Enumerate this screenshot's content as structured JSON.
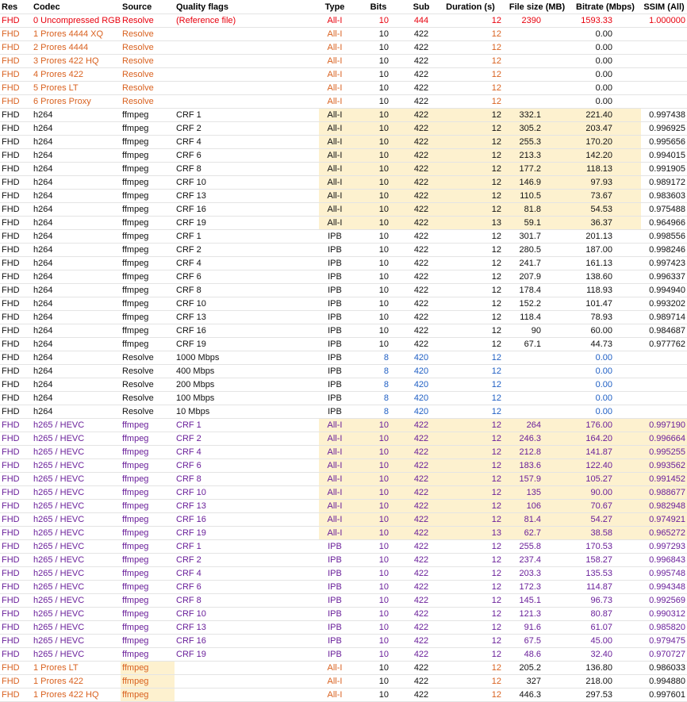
{
  "columns": [
    "Res",
    "Codec",
    "Source",
    "Quality flags",
    "Type",
    "Bits",
    "Sub",
    "Duration (s)",
    "File size (MB)",
    "Bitrate (Mbps)",
    "SSIM (All)"
  ],
  "colors": {
    "red": "#e8000d",
    "orange": "#d9611f",
    "black": "#111111",
    "blue": "#1f5fc4",
    "purple": "#6a1f9a",
    "highlight": "#fdf1cf"
  },
  "rows": [
    {
      "cells": [
        "FHD",
        "0 Uncompressed RGB",
        "Resolve",
        "(Reference file)",
        "All-I",
        "10",
        "444",
        "12",
        "2390",
        "1593.33",
        "1.000000"
      ],
      "color": "red",
      "hl": []
    },
    {
      "cells": [
        "FHD",
        "1 Prores 4444 XQ",
        "Resolve",
        "",
        "All-I",
        "10",
        "422",
        "12",
        "",
        "0.00",
        ""
      ],
      "color": "orange",
      "black": [
        5,
        6,
        9
      ],
      "hl": []
    },
    {
      "cells": [
        "FHD",
        "2 Prores 4444",
        "Resolve",
        "",
        "All-I",
        "10",
        "422",
        "12",
        "",
        "0.00",
        ""
      ],
      "color": "orange",
      "black": [
        5,
        6,
        9
      ],
      "hl": []
    },
    {
      "cells": [
        "FHD",
        "3 Prores 422 HQ",
        "Resolve",
        "",
        "All-I",
        "10",
        "422",
        "12",
        "",
        "0.00",
        ""
      ],
      "color": "orange",
      "black": [
        5,
        6,
        9
      ],
      "hl": []
    },
    {
      "cells": [
        "FHD",
        "4 Prores 422",
        "Resolve",
        "",
        "All-I",
        "10",
        "422",
        "12",
        "",
        "0.00",
        ""
      ],
      "color": "orange",
      "black": [
        5,
        6,
        9
      ],
      "hl": []
    },
    {
      "cells": [
        "FHD",
        "5 Prores LT",
        "Resolve",
        "",
        "All-I",
        "10",
        "422",
        "12",
        "",
        "0.00",
        ""
      ],
      "color": "orange",
      "black": [
        5,
        6,
        9
      ],
      "hl": []
    },
    {
      "cells": [
        "FHD",
        "6 Prores Proxy",
        "Resolve",
        "",
        "All-I",
        "10",
        "422",
        "12",
        "",
        "0.00",
        ""
      ],
      "color": "orange",
      "black": [
        5,
        6,
        9
      ],
      "hl": []
    },
    {
      "cells": [
        "FHD",
        "h264",
        "ffmpeg",
        "CRF 1",
        "All-I",
        "10",
        "422",
        "12",
        "332.1",
        "221.40",
        "0.997438"
      ],
      "color": "black",
      "hl": [
        4,
        5,
        6,
        7,
        8,
        9
      ]
    },
    {
      "cells": [
        "FHD",
        "h264",
        "ffmpeg",
        "CRF 2",
        "All-I",
        "10",
        "422",
        "12",
        "305.2",
        "203.47",
        "0.996925"
      ],
      "color": "black",
      "hl": [
        4,
        5,
        6,
        7,
        8,
        9
      ]
    },
    {
      "cells": [
        "FHD",
        "h264",
        "ffmpeg",
        "CRF 4",
        "All-I",
        "10",
        "422",
        "12",
        "255.3",
        "170.20",
        "0.995656"
      ],
      "color": "black",
      "hl": [
        4,
        5,
        6,
        7,
        8,
        9
      ]
    },
    {
      "cells": [
        "FHD",
        "h264",
        "ffmpeg",
        "CRF 6",
        "All-I",
        "10",
        "422",
        "12",
        "213.3",
        "142.20",
        "0.994015"
      ],
      "color": "black",
      "hl": [
        4,
        5,
        6,
        7,
        8,
        9
      ]
    },
    {
      "cells": [
        "FHD",
        "h264",
        "ffmpeg",
        "CRF 8",
        "All-I",
        "10",
        "422",
        "12",
        "177.2",
        "118.13",
        "0.991905"
      ],
      "color": "black",
      "hl": [
        4,
        5,
        6,
        7,
        8,
        9
      ]
    },
    {
      "cells": [
        "FHD",
        "h264",
        "ffmpeg",
        "CRF 10",
        "All-I",
        "10",
        "422",
        "12",
        "146.9",
        "97.93",
        "0.989172"
      ],
      "color": "black",
      "hl": [
        4,
        5,
        6,
        7,
        8,
        9
      ]
    },
    {
      "cells": [
        "FHD",
        "h264",
        "ffmpeg",
        "CRF 13",
        "All-I",
        "10",
        "422",
        "12",
        "110.5",
        "73.67",
        "0.983603"
      ],
      "color": "black",
      "hl": [
        4,
        5,
        6,
        7,
        8,
        9
      ]
    },
    {
      "cells": [
        "FHD",
        "h264",
        "ffmpeg",
        "CRF 16",
        "All-I",
        "10",
        "422",
        "12",
        "81.8",
        "54.53",
        "0.975488"
      ],
      "color": "black",
      "hl": [
        4,
        5,
        6,
        7,
        8,
        9
      ]
    },
    {
      "cells": [
        "FHD",
        "h264",
        "ffmpeg",
        "CRF 19",
        "All-I",
        "10",
        "422",
        "13",
        "59.1",
        "36.37",
        "0.964966"
      ],
      "color": "black",
      "hl": [
        4,
        5,
        6,
        7,
        8,
        9
      ]
    },
    {
      "cells": [
        "FHD",
        "h264",
        "ffmpeg",
        "CRF 1",
        "IPB",
        "10",
        "422",
        "12",
        "301.7",
        "201.13",
        "0.998556"
      ],
      "color": "black",
      "hl": []
    },
    {
      "cells": [
        "FHD",
        "h264",
        "ffmpeg",
        "CRF 2",
        "IPB",
        "10",
        "422",
        "12",
        "280.5",
        "187.00",
        "0.998246"
      ],
      "color": "black",
      "hl": []
    },
    {
      "cells": [
        "FHD",
        "h264",
        "ffmpeg",
        "CRF 4",
        "IPB",
        "10",
        "422",
        "12",
        "241.7",
        "161.13",
        "0.997423"
      ],
      "color": "black",
      "hl": []
    },
    {
      "cells": [
        "FHD",
        "h264",
        "ffmpeg",
        "CRF 6",
        "IPB",
        "10",
        "422",
        "12",
        "207.9",
        "138.60",
        "0.996337"
      ],
      "color": "black",
      "hl": []
    },
    {
      "cells": [
        "FHD",
        "h264",
        "ffmpeg",
        "CRF 8",
        "IPB",
        "10",
        "422",
        "12",
        "178.4",
        "118.93",
        "0.994940"
      ],
      "color": "black",
      "hl": []
    },
    {
      "cells": [
        "FHD",
        "h264",
        "ffmpeg",
        "CRF 10",
        "IPB",
        "10",
        "422",
        "12",
        "152.2",
        "101.47",
        "0.993202"
      ],
      "color": "black",
      "hl": []
    },
    {
      "cells": [
        "FHD",
        "h264",
        "ffmpeg",
        "CRF 13",
        "IPB",
        "10",
        "422",
        "12",
        "118.4",
        "78.93",
        "0.989714"
      ],
      "color": "black",
      "hl": []
    },
    {
      "cells": [
        "FHD",
        "h264",
        "ffmpeg",
        "CRF 16",
        "IPB",
        "10",
        "422",
        "12",
        "90",
        "60.00",
        "0.984687"
      ],
      "color": "black",
      "hl": []
    },
    {
      "cells": [
        "FHD",
        "h264",
        "ffmpeg",
        "CRF 19",
        "IPB",
        "10",
        "422",
        "12",
        "67.1",
        "44.73",
        "0.977762"
      ],
      "color": "black",
      "hl": []
    },
    {
      "cells": [
        "FHD",
        "h264",
        "Resolve",
        "1000 Mbps",
        "IPB",
        "8",
        "420",
        "12",
        "",
        "0.00",
        ""
      ],
      "color": "black",
      "blue": [
        5,
        6,
        7,
        9
      ],
      "hl": []
    },
    {
      "cells": [
        "FHD",
        "h264",
        "Resolve",
        "400 Mbps",
        "IPB",
        "8",
        "420",
        "12",
        "",
        "0.00",
        ""
      ],
      "color": "black",
      "blue": [
        5,
        6,
        7,
        9
      ],
      "hl": []
    },
    {
      "cells": [
        "FHD",
        "h264",
        "Resolve",
        "200 Mbps",
        "IPB",
        "8",
        "420",
        "12",
        "",
        "0.00",
        ""
      ],
      "color": "black",
      "blue": [
        5,
        6,
        7,
        9
      ],
      "hl": []
    },
    {
      "cells": [
        "FHD",
        "h264",
        "Resolve",
        "100 Mbps",
        "IPB",
        "8",
        "420",
        "12",
        "",
        "0.00",
        ""
      ],
      "color": "black",
      "blue": [
        5,
        6,
        7,
        9
      ],
      "hl": []
    },
    {
      "cells": [
        "FHD",
        "h264",
        "Resolve",
        "10 Mbps",
        "IPB",
        "8",
        "420",
        "12",
        "",
        "0.00",
        ""
      ],
      "color": "black",
      "blue": [
        5,
        6,
        7,
        9
      ],
      "hl": []
    },
    {
      "cells": [
        "FHD",
        "h265 / HEVC",
        "ffmpeg",
        "CRF 1",
        "All-I",
        "10",
        "422",
        "12",
        "264",
        "176.00",
        "0.997190"
      ],
      "color": "purple",
      "hl": [
        4,
        5,
        6,
        7,
        8,
        9,
        10
      ]
    },
    {
      "cells": [
        "FHD",
        "h265 / HEVC",
        "ffmpeg",
        "CRF 2",
        "All-I",
        "10",
        "422",
        "12",
        "246.3",
        "164.20",
        "0.996664"
      ],
      "color": "purple",
      "hl": [
        4,
        5,
        6,
        7,
        8,
        9,
        10
      ]
    },
    {
      "cells": [
        "FHD",
        "h265 / HEVC",
        "ffmpeg",
        "CRF 4",
        "All-I",
        "10",
        "422",
        "12",
        "212.8",
        "141.87",
        "0.995255"
      ],
      "color": "purple",
      "hl": [
        4,
        5,
        6,
        7,
        8,
        9,
        10
      ]
    },
    {
      "cells": [
        "FHD",
        "h265 / HEVC",
        "ffmpeg",
        "CRF 6",
        "All-I",
        "10",
        "422",
        "12",
        "183.6",
        "122.40",
        "0.993562"
      ],
      "color": "purple",
      "hl": [
        4,
        5,
        6,
        7,
        8,
        9,
        10
      ]
    },
    {
      "cells": [
        "FHD",
        "h265 / HEVC",
        "ffmpeg",
        "CRF 8",
        "All-I",
        "10",
        "422",
        "12",
        "157.9",
        "105.27",
        "0.991452"
      ],
      "color": "purple",
      "hl": [
        4,
        5,
        6,
        7,
        8,
        9,
        10
      ]
    },
    {
      "cells": [
        "FHD",
        "h265 / HEVC",
        "ffmpeg",
        "CRF 10",
        "All-I",
        "10",
        "422",
        "12",
        "135",
        "90.00",
        "0.988677"
      ],
      "color": "purple",
      "hl": [
        4,
        5,
        6,
        7,
        8,
        9,
        10
      ]
    },
    {
      "cells": [
        "FHD",
        "h265 / HEVC",
        "ffmpeg",
        "CRF 13",
        "All-I",
        "10",
        "422",
        "12",
        "106",
        "70.67",
        "0.982948"
      ],
      "color": "purple",
      "hl": [
        4,
        5,
        6,
        7,
        8,
        9,
        10
      ]
    },
    {
      "cells": [
        "FHD",
        "h265 / HEVC",
        "ffmpeg",
        "CRF 16",
        "All-I",
        "10",
        "422",
        "12",
        "81.4",
        "54.27",
        "0.974921"
      ],
      "color": "purple",
      "hl": [
        4,
        5,
        6,
        7,
        8,
        9,
        10
      ]
    },
    {
      "cells": [
        "FHD",
        "h265 / HEVC",
        "ffmpeg",
        "CRF 19",
        "All-I",
        "10",
        "422",
        "13",
        "62.7",
        "38.58",
        "0.965272"
      ],
      "color": "purple",
      "hl": [
        4,
        5,
        6,
        7,
        8,
        9,
        10
      ]
    },
    {
      "cells": [
        "FHD",
        "h265 / HEVC",
        "ffmpeg",
        "CRF 1",
        "IPB",
        "10",
        "422",
        "12",
        "255.8",
        "170.53",
        "0.997293"
      ],
      "color": "purple",
      "hl": []
    },
    {
      "cells": [
        "FHD",
        "h265 / HEVC",
        "ffmpeg",
        "CRF 2",
        "IPB",
        "10",
        "422",
        "12",
        "237.4",
        "158.27",
        "0.996843"
      ],
      "color": "purple",
      "hl": []
    },
    {
      "cells": [
        "FHD",
        "h265 / HEVC",
        "ffmpeg",
        "CRF 4",
        "IPB",
        "10",
        "422",
        "12",
        "203.3",
        "135.53",
        "0.995748"
      ],
      "color": "purple",
      "hl": []
    },
    {
      "cells": [
        "FHD",
        "h265 / HEVC",
        "ffmpeg",
        "CRF 6",
        "IPB",
        "10",
        "422",
        "12",
        "172.3",
        "114.87",
        "0.994348"
      ],
      "color": "purple",
      "hl": []
    },
    {
      "cells": [
        "FHD",
        "h265 / HEVC",
        "ffmpeg",
        "CRF 8",
        "IPB",
        "10",
        "422",
        "12",
        "145.1",
        "96.73",
        "0.992569"
      ],
      "color": "purple",
      "hl": []
    },
    {
      "cells": [
        "FHD",
        "h265 / HEVC",
        "ffmpeg",
        "CRF 10",
        "IPB",
        "10",
        "422",
        "12",
        "121.3",
        "80.87",
        "0.990312"
      ],
      "color": "purple",
      "hl": []
    },
    {
      "cells": [
        "FHD",
        "h265 / HEVC",
        "ffmpeg",
        "CRF 13",
        "IPB",
        "10",
        "422",
        "12",
        "91.6",
        "61.07",
        "0.985820"
      ],
      "color": "purple",
      "hl": []
    },
    {
      "cells": [
        "FHD",
        "h265 / HEVC",
        "ffmpeg",
        "CRF 16",
        "IPB",
        "10",
        "422",
        "12",
        "67.5",
        "45.00",
        "0.979475"
      ],
      "color": "purple",
      "hl": []
    },
    {
      "cells": [
        "FHD",
        "h265 / HEVC",
        "ffmpeg",
        "CRF 19",
        "IPB",
        "10",
        "422",
        "12",
        "48.6",
        "32.40",
        "0.970727"
      ],
      "color": "purple",
      "hl": []
    },
    {
      "cells": [
        "FHD",
        "1 Prores LT",
        "ffmpeg",
        "",
        "All-I",
        "10",
        "422",
        "12",
        "205.2",
        "136.80",
        "0.986033"
      ],
      "color": "orange",
      "black": [
        5,
        6,
        8,
        9,
        10
      ],
      "hl": [
        2
      ]
    },
    {
      "cells": [
        "FHD",
        "1 Prores 422",
        "ffmpeg",
        "",
        "All-I",
        "10",
        "422",
        "12",
        "327",
        "218.00",
        "0.994880"
      ],
      "color": "orange",
      "black": [
        5,
        6,
        8,
        9,
        10
      ],
      "hl": [
        2
      ]
    },
    {
      "cells": [
        "FHD",
        "1 Prores 422 HQ",
        "ffmpeg",
        "",
        "All-I",
        "10",
        "422",
        "12",
        "446.3",
        "297.53",
        "0.997601"
      ],
      "color": "orange",
      "black": [
        5,
        6,
        8,
        9,
        10
      ],
      "hl": [
        2
      ]
    }
  ]
}
